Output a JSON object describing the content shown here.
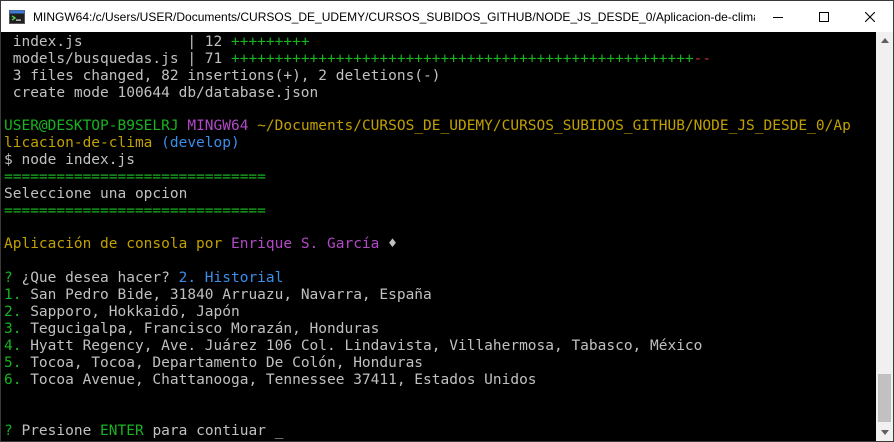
{
  "window": {
    "title": "MINGW64:/c/Users/USER/Documents/CURSOS_DE_UDEMY/CURSOS_SUBIDOS_GITHUB/NODE_JS_DESDE_0/Aplicacion-de-clima"
  },
  "controls": {
    "minimize": "minimize-icon",
    "maximize": "maximize-icon",
    "close": "close-icon"
  },
  "terminal": {
    "git_stat": [
      {
        "file": " index.js            | 12 ",
        "plus": "+++++++++",
        "minus": ""
      },
      {
        "file": " models/busquedas.js | 71 ",
        "plus": "+++++++++++++++++++++++++++++++++++++++++++++++++++++",
        "minus": "--"
      }
    ],
    "summary": " 3 files changed, 82 insertions(+), 2 deletions(-)",
    "create": " create mode 100644 db/database.json",
    "prompt": {
      "user": "USER@DESKTOP-B9SELRJ",
      "env": "MINGW64",
      "path_line1": "~/Documents/CURSOS_DE_UDEMY/CURSOS_SUBIDOS_GITHUB/NODE_JS_DESDE_0/Ap",
      "path_line2": "licacion-de-clima",
      "branch": "(develop)",
      "command": "$ node index.js"
    },
    "separator": "==============================",
    "menu_title": "Seleccione una opcion",
    "app_label": "Aplicación de consola por",
    "author": "Enrique S. García",
    "author_glyph": "♦",
    "question_mark": "?",
    "question": "¿Que desea hacer?",
    "answer": "2. Historial",
    "history": [
      {
        "num": "1.",
        "place": "San Pedro Bide, 31840 Arruazu, Navarra, España"
      },
      {
        "num": "2.",
        "place": "Sapporo, Hokkaidō, Japón"
      },
      {
        "num": "3.",
        "place": "Tegucigalpa, Francisco Morazán, Honduras"
      },
      {
        "num": "4.",
        "place": "Hyatt Regency, Ave. Juárez 106 Col. Lindavista, Villahermosa, Tabasco, México"
      },
      {
        "num": "5.",
        "place": "Tocoa, Tocoa, Departamento De Colón, Honduras"
      },
      {
        "num": "6.",
        "place": "Tocoa Avenue, Chattanooga, Tennessee 37411, Estados Unidos"
      }
    ],
    "enter_prompt": {
      "pre": "Presione",
      "key": "ENTER",
      "post": "para contiuar",
      "cursor": "_"
    }
  }
}
